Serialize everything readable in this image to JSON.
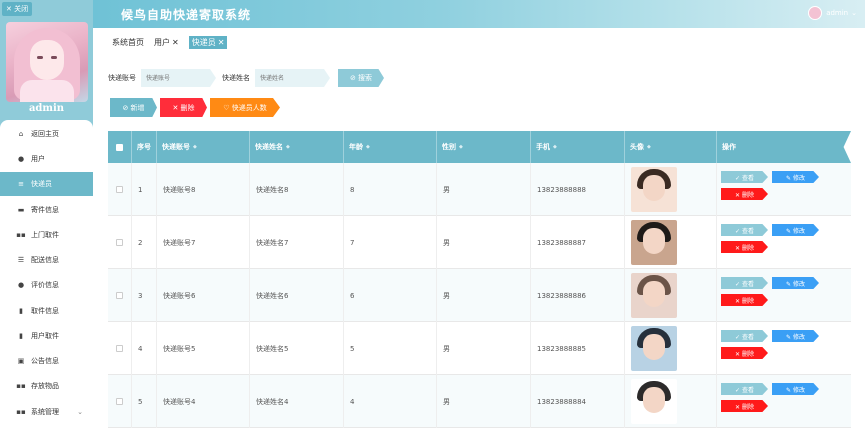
{
  "sidebar": {
    "close_label": "✕ 关闭",
    "admin_name": "admin",
    "items": [
      {
        "label": "返回主页",
        "icon": "home-icon"
      },
      {
        "label": "用户",
        "icon": "user-icon"
      },
      {
        "label": "快递员",
        "icon": "list-icon"
      },
      {
        "label": "寄件信息",
        "icon": "monitor-icon"
      },
      {
        "label": "上门取件",
        "icon": "grid-icon"
      },
      {
        "label": "配送信息",
        "icon": "sliders-icon"
      },
      {
        "label": "评价信息",
        "icon": "pin-icon"
      },
      {
        "label": "取件信息",
        "icon": "trash-icon"
      },
      {
        "label": "用户取件",
        "icon": "bucket-icon"
      },
      {
        "label": "公告信息",
        "icon": "picture-icon"
      },
      {
        "label": "存放物品",
        "icon": "grid-icon"
      },
      {
        "label": "系统管理",
        "icon": "grid-icon"
      }
    ]
  },
  "header": {
    "title": "候鸟自助快递寄取系统",
    "user": "admin"
  },
  "tabs": [
    {
      "label": "系统首页",
      "closable": ""
    },
    {
      "label": "用户",
      "closable": "✕"
    },
    {
      "label": "快递员",
      "closable": "✕"
    }
  ],
  "search": {
    "account_label": "快递账号",
    "account_placeholder": "快递账号",
    "name_label": "快递姓名",
    "name_placeholder": "快递姓名",
    "button": "⊘ 搜索"
  },
  "actions": {
    "add": "⊘ 新增",
    "delete": "✕ 删除",
    "count": "♡ 快递员人数"
  },
  "table": {
    "headers": [
      "序号",
      "快递账号",
      "快递姓名",
      "年龄",
      "性别",
      "手机",
      "头像",
      "操作"
    ],
    "rows": [
      {
        "index": "1",
        "account": "快递账号8",
        "name": "快递姓名8",
        "age": "8",
        "gender": "男",
        "phone": "13823888888"
      },
      {
        "index": "2",
        "account": "快递账号7",
        "name": "快递姓名7",
        "age": "7",
        "gender": "男",
        "phone": "13823888887"
      },
      {
        "index": "3",
        "account": "快递账号6",
        "name": "快递姓名6",
        "age": "6",
        "gender": "男",
        "phone": "13823888886"
      },
      {
        "index": "4",
        "account": "快递账号5",
        "name": "快递姓名5",
        "age": "5",
        "gender": "男",
        "phone": "13823888885"
      },
      {
        "index": "5",
        "account": "快递账号4",
        "name": "快递姓名4",
        "age": "4",
        "gender": "男",
        "phone": "13823888884"
      }
    ],
    "view_label": "✓ 查看",
    "edit_label": "✎ 修改",
    "remove_label": "✕ 删除"
  },
  "colors": {
    "primary": "#6cb8c9",
    "danger": "#ff2d3a",
    "warning": "#ff8a14",
    "edit": "#3a9ff5"
  }
}
